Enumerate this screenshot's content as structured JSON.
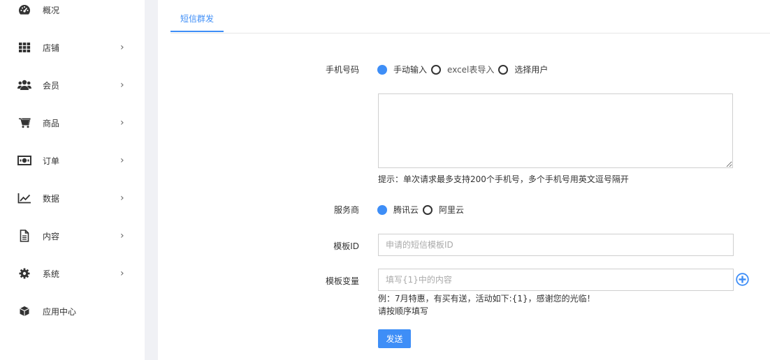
{
  "sidebar": {
    "items": [
      {
        "label": "概况",
        "icon": "dashboard-icon",
        "has_arrow": false
      },
      {
        "label": "店铺",
        "icon": "grid-icon",
        "has_arrow": true
      },
      {
        "label": "会员",
        "icon": "users-icon",
        "has_arrow": true
      },
      {
        "label": "商品",
        "icon": "cart-icon",
        "has_arrow": true
      },
      {
        "label": "订单",
        "icon": "money-icon",
        "has_arrow": true
      },
      {
        "label": "数据",
        "icon": "line-chart-icon",
        "has_arrow": true
      },
      {
        "label": "内容",
        "icon": "document-icon",
        "has_arrow": true
      },
      {
        "label": "系统",
        "icon": "gear-icon",
        "has_arrow": true
      },
      {
        "label": "应用中心",
        "icon": "cube-icon",
        "has_arrow": false
      }
    ],
    "arrow": "›"
  },
  "tabs": [
    {
      "label": "短信群发",
      "active": true
    }
  ],
  "form": {
    "phone": {
      "label": "手机号码",
      "options": [
        {
          "label": "手动输入",
          "checked": true
        },
        {
          "label": "excel表导入",
          "checked": false
        },
        {
          "label": "选择用户",
          "checked": false
        }
      ],
      "textarea_value": "",
      "hint": "提示：单次请求最多支持200个手机号，多个手机号用英文逗号隔开"
    },
    "provider": {
      "label": "服务商",
      "options": [
        {
          "label": "腾讯云",
          "checked": true
        },
        {
          "label": "阿里云",
          "checked": false
        }
      ]
    },
    "template_id": {
      "label": "模板ID",
      "value": "",
      "placeholder": "申请的短信模板ID"
    },
    "template_vars": {
      "label": "模板变量",
      "value": "",
      "placeholder": "填写{1}中的内容",
      "example": "例：7月特惠，有买有送，活动如下:{1}，感谢您的光临！",
      "note": "请按顺序填写"
    },
    "submit_label": "发送"
  },
  "colors": {
    "accent": "#3e8ef7",
    "gutter": "#f0f1f5"
  }
}
